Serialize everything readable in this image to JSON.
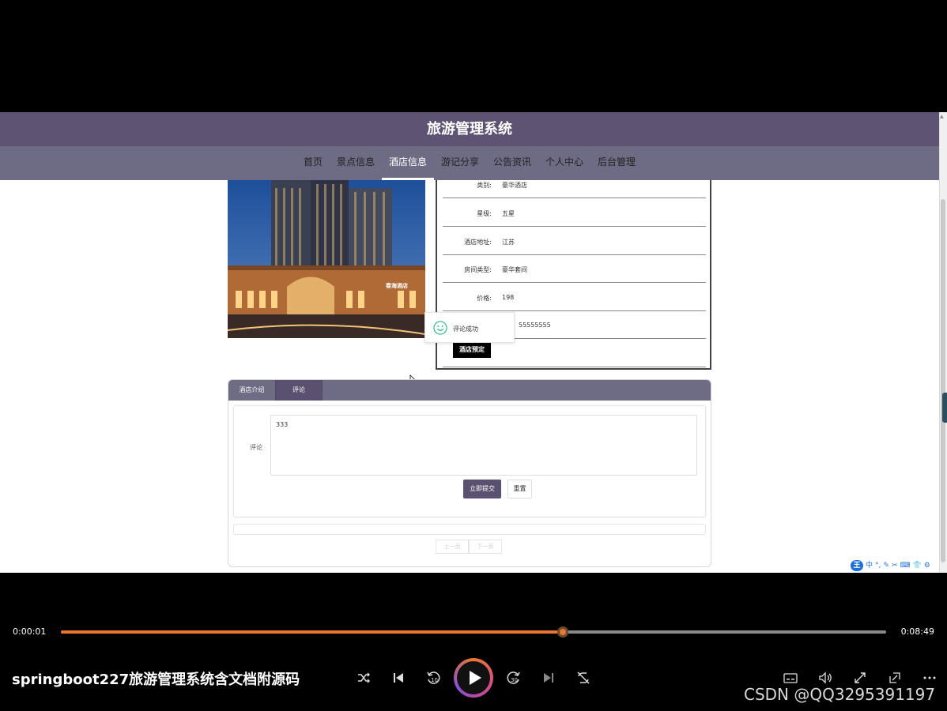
{
  "site": {
    "title": "旅游管理系统",
    "nav": [
      "首页",
      "景点信息",
      "酒店信息",
      "游记分享",
      "公告资讯",
      "个人中心",
      "后台管理"
    ],
    "active_nav": "酒店信息"
  },
  "hotel": {
    "photo_sign": "春海酒店",
    "fields": [
      {
        "label": "类别:",
        "value": "豪华酒店"
      },
      {
        "label": "星级:",
        "value": "五星"
      },
      {
        "label": "酒店地址:",
        "value": "江苏"
      },
      {
        "label": "房间类型:",
        "value": "豪华套间"
      },
      {
        "label": "价格:",
        "value": "198"
      },
      {
        "label": "",
        "value": "55555555"
      }
    ],
    "book_label": "酒店预定"
  },
  "toast": {
    "text": "评论成功"
  },
  "tabs": {
    "items": [
      "酒店介绍",
      "评论"
    ],
    "active": "评论"
  },
  "comment_form": {
    "label": "评论",
    "value": "333",
    "submit_label": "立即提交",
    "reset_label": "重置"
  },
  "pager": {
    "prev": "上一页",
    "next": "下一页"
  },
  "ime": {
    "logo": "王",
    "items": [
      "中",
      "°,",
      "✎",
      "✂",
      "⌨",
      "👕",
      "⚙"
    ]
  },
  "player": {
    "current_time": "0:00:01",
    "total_time": "0:08:49",
    "progress": 0.608,
    "video_title": "springboot227旅游管理系统含文档附源码",
    "accent_color": "#e8772f"
  },
  "watermark": "CSDN @QQ3295391197"
}
